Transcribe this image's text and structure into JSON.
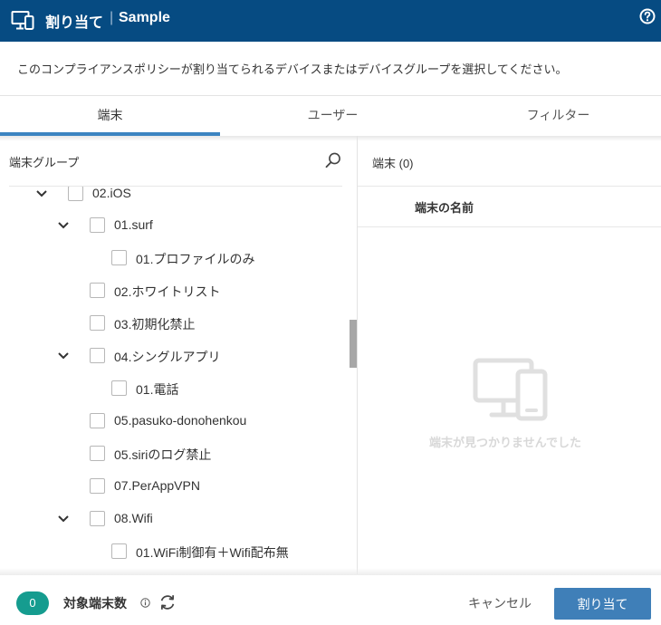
{
  "header": {
    "title": "割り当て",
    "separator": "|",
    "subtitle": "Sample",
    "icon": "monitor-icon",
    "help_icon": "help-icon"
  },
  "description": "このコンプライアンスポリシーが割り当てられるデバイスまたはデバイスグループを選択してください。",
  "tabs": [
    {
      "label": "端末",
      "active": true
    },
    {
      "label": "ユーザー",
      "active": false
    },
    {
      "label": "フィルター",
      "active": false
    }
  ],
  "left_panel": {
    "title": "端末グループ",
    "tree": [
      {
        "label": "02.iOS",
        "expanded": true
      },
      {
        "label": "01.surf",
        "expanded": true
      },
      {
        "label": "01.プロファイルのみ"
      },
      {
        "label": "02.ホワイトリスト"
      },
      {
        "label": "03.初期化禁止"
      },
      {
        "label": "04.シングルアプリ",
        "expanded": true
      },
      {
        "label": "01.電話"
      },
      {
        "label": "05.pasuko-donohenkou"
      },
      {
        "label": "05.siriのログ禁止"
      },
      {
        "label": "07.PerAppVPN"
      },
      {
        "label": "08.Wifi",
        "expanded": true
      },
      {
        "label": "01.WiFi制御有＋Wifi配布無"
      }
    ]
  },
  "right_panel": {
    "title": "端末 (0)",
    "column_header": "端末の名前",
    "empty_text": "端末が見つかりませんでした"
  },
  "footer": {
    "count": "0",
    "count_label": "対象端末数",
    "cancel_label": "キャンセル",
    "assign_label": "割り当て"
  },
  "colors": {
    "header_bg": "#064b82",
    "accent": "#3c84c1",
    "badge": "#159c8f",
    "primary_button": "#3f7fb8"
  }
}
